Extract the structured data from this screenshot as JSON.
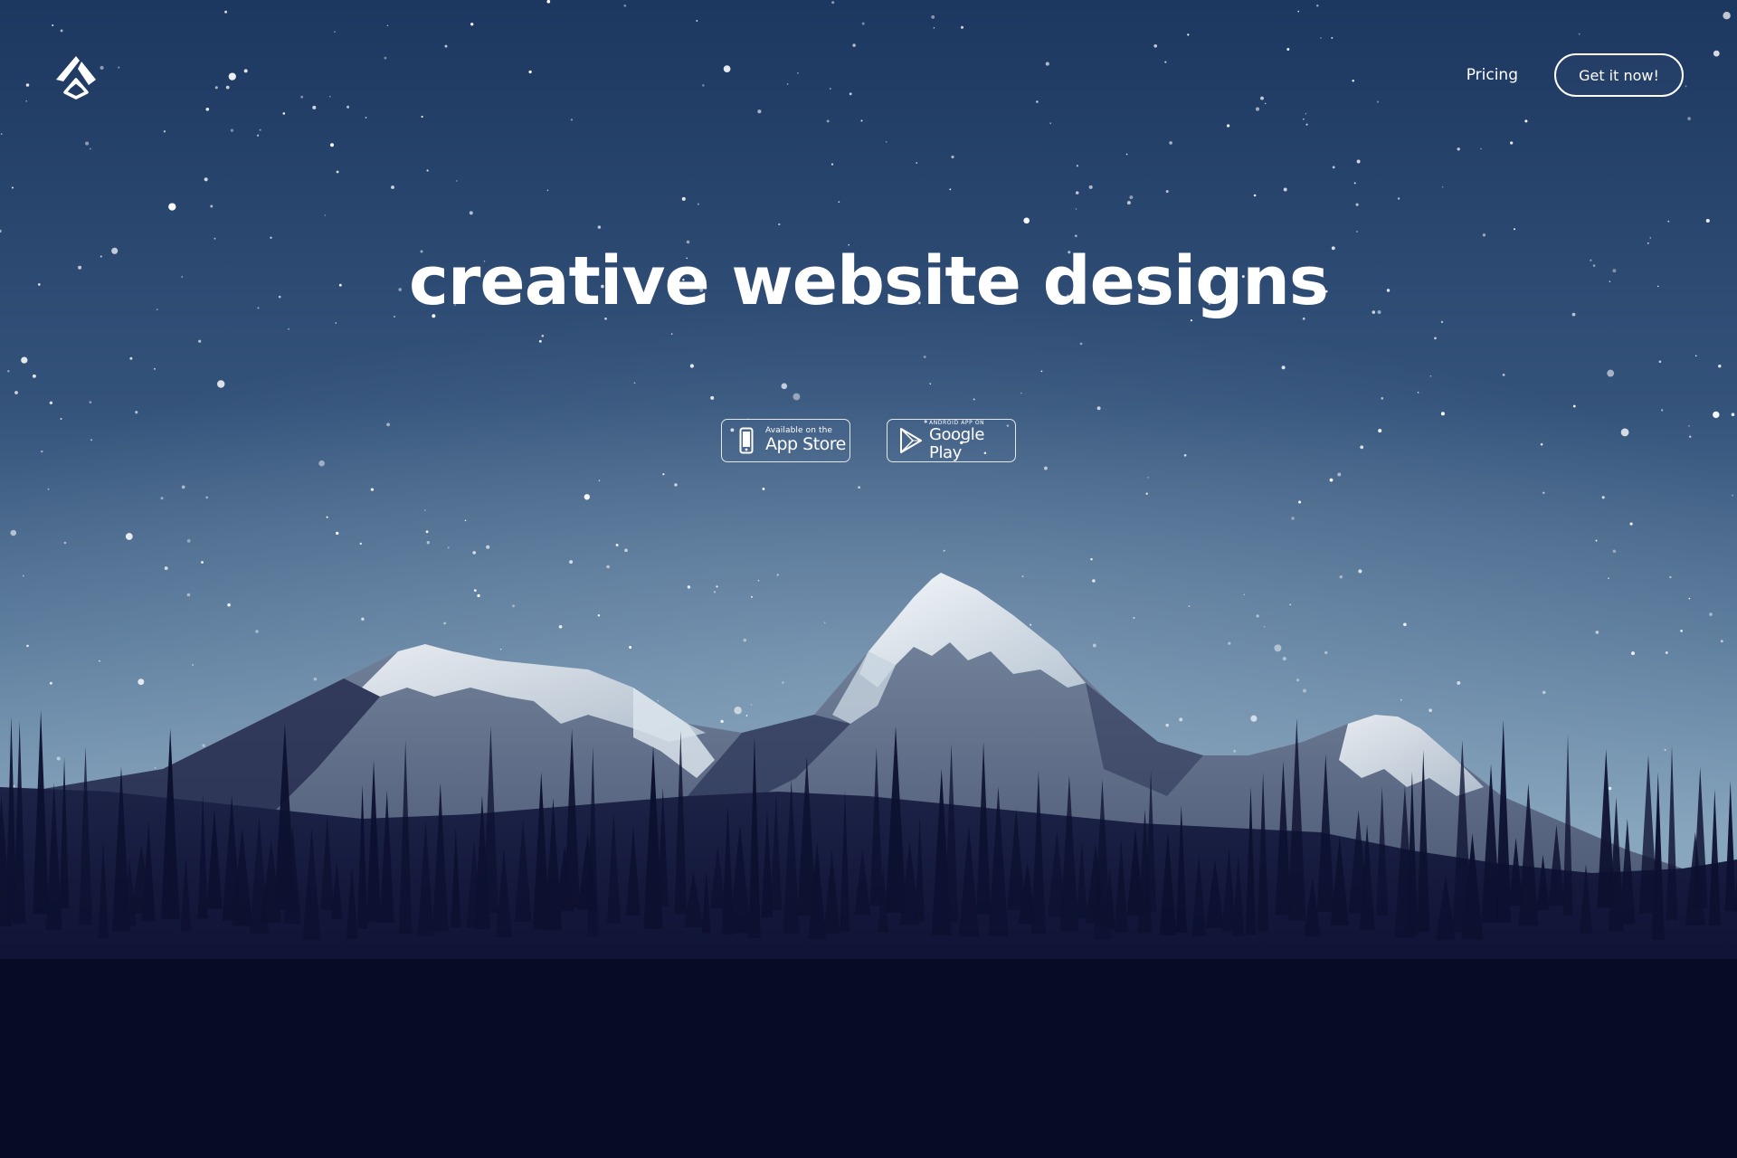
{
  "header": {
    "logo_icon": "brand-logo-icon",
    "nav": {
      "pricing_label": "Pricing",
      "cta_label": "Get it now!"
    }
  },
  "hero": {
    "title": "creative website designs",
    "stores": {
      "app_store": {
        "icon": "phone-icon",
        "small": "Available on the",
        "large": "App Store"
      },
      "google_play": {
        "icon": "play-triangle-icon",
        "small": "ANDROID APP ON",
        "large": "Google Play"
      }
    }
  },
  "colors": {
    "sky_top": "#1c3760",
    "sky_mid": "#4f6f93",
    "sky_horizon": "#86a4bc",
    "forest": "#0d1130",
    "text": "#ffffff"
  }
}
